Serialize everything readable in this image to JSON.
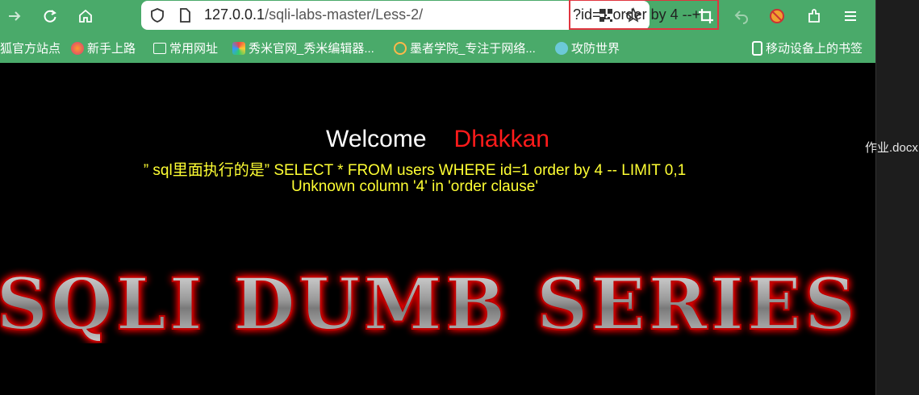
{
  "browser": {
    "url_host": "127.0.0.1",
    "url_path": "/sqli-labs-master/Less-2/",
    "url_query": "?id=1 order by 4 --+",
    "icons": [
      "forward-icon",
      "reload-icon",
      "home-icon",
      "shield-icon",
      "page-icon",
      "qr-icon",
      "star-icon",
      "crop-icon",
      "undo-icon",
      "blocked-icon",
      "extension-icon",
      "menu-icon"
    ],
    "bookmarks": [
      {
        "label": "狐官方站点"
      },
      {
        "label": "新手上路"
      },
      {
        "label": "常用网址"
      },
      {
        "label": "秀米官网_秀米编辑器..."
      },
      {
        "label": "墨者学院_专注于网络..."
      },
      {
        "label": "攻防世界"
      },
      {
        "label": "移动设备上的书签"
      }
    ],
    "colors": {
      "chrome": "#4aaa6a",
      "highlight": "#e0353f"
    }
  },
  "page": {
    "welcome": "Welcome",
    "name": "Dhakkan",
    "sql_line": "” sql里面执行的是” SELECT * FROM users WHERE id=1 order by 4 -- LIMIT 0,1",
    "error_line": "Unknown column '4' in 'order clause'",
    "banner": "SQLI DUMB SERIES",
    "colors": {
      "welcome": "#ffffff",
      "name": "#ff1b1b",
      "sql": "#ffff33"
    }
  },
  "side": {
    "file_label": "作业.docx"
  }
}
